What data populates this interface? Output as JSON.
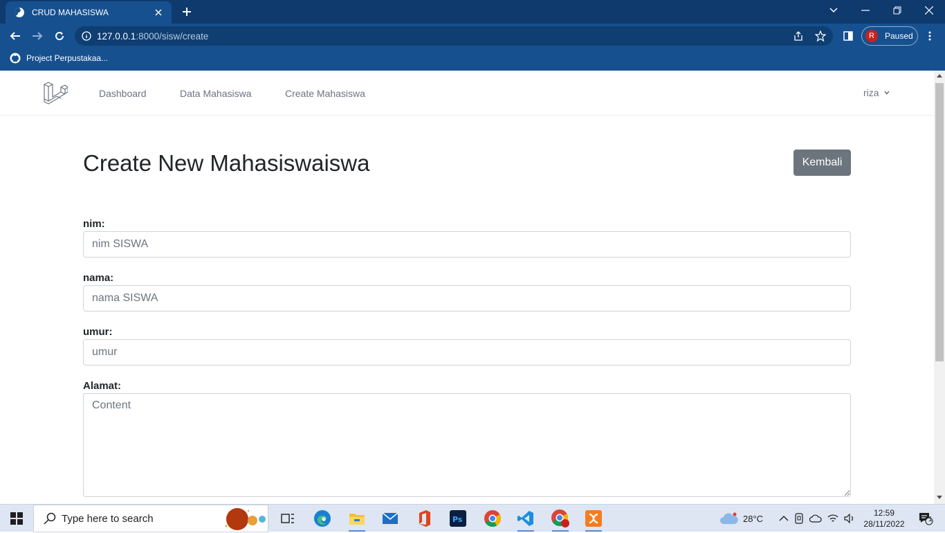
{
  "browser": {
    "tab_title": "CRUD MAHASISWA",
    "url_host": "127.0.0.1",
    "url_rest": ":8000/sisw/create",
    "profile_initial": "R",
    "profile_status": "Paused",
    "bookmark_label": "Project Perpustakaa..."
  },
  "app": {
    "nav": {
      "dashboard": "Dashboard",
      "data_mahasiswa": "Data Mahasiswa",
      "create_mahasiswa": "Create Mahasiswa",
      "user": "riza"
    },
    "page_title": "Create New Mahasiswaiswa",
    "back_button": "Kembali",
    "form": {
      "nim_label": "nim:",
      "nim_placeholder": "nim SISWA",
      "nama_label": "nama:",
      "nama_placeholder": "nama SISWA",
      "umur_label": "umur:",
      "umur_placeholder": "umur",
      "alamat_label": "Alamat:",
      "alamat_placeholder": "Content"
    }
  },
  "taskbar": {
    "search_placeholder": "Type here to search",
    "temperature": "28°C",
    "time": "12:59",
    "date": "28/11/2022",
    "notification_count": "1"
  },
  "colors": {
    "browser_frame": "#16508f",
    "tab_strip": "#0e3a6e",
    "back_button": "#6c757d",
    "nav_text": "#6b7280"
  }
}
